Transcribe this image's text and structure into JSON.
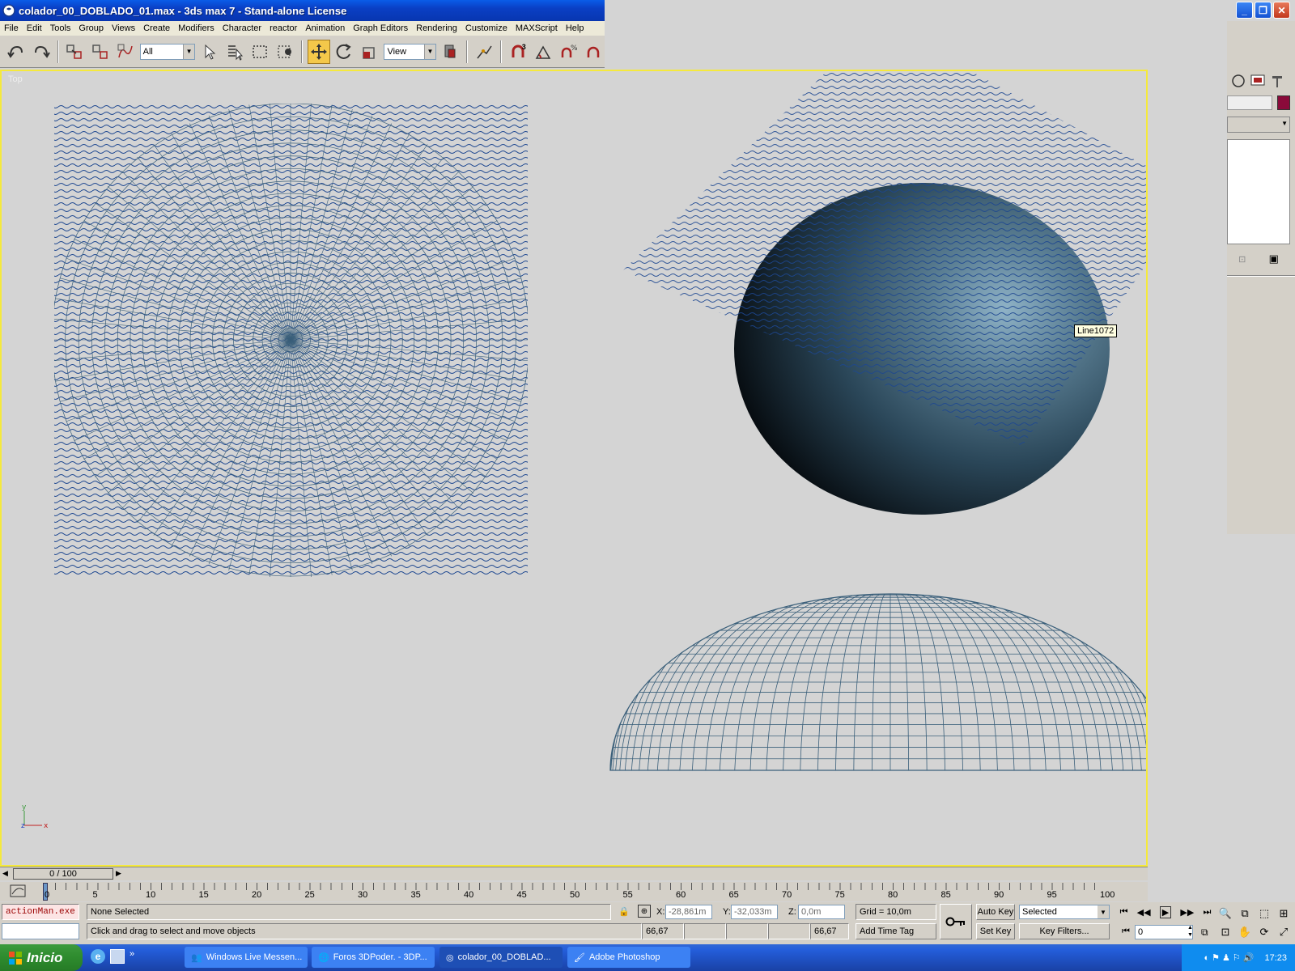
{
  "window": {
    "title": "colador_00_DOBLADO_01.max - 3ds max 7  - Stand-alone License"
  },
  "menu": [
    "File",
    "Edit",
    "Tools",
    "Group",
    "Views",
    "Create",
    "Modifiers",
    "Character",
    "reactor",
    "Animation",
    "Graph Editors",
    "Rendering",
    "Customize",
    "MAXScript",
    "Help"
  ],
  "toolbar": {
    "selection_filter": "All",
    "reference_coord": "View",
    "snap_label": "3"
  },
  "viewport": {
    "tooltip": "Line1072",
    "axis_x": "x",
    "axis_y": "y",
    "axis_z": "z"
  },
  "timeslider": {
    "label": "0 / 100"
  },
  "trackbar": {
    "ticks": [
      "0",
      "5",
      "10",
      "15",
      "20",
      "25",
      "30",
      "35",
      "40",
      "45",
      "50",
      "55",
      "60",
      "65",
      "70",
      "75",
      "80",
      "85",
      "90",
      "95",
      "100"
    ]
  },
  "status": {
    "script_listener": "actionMan.exe",
    "selection": "None Selected",
    "prompt": "Click and drag to select and move objects",
    "x_label": "X:",
    "x_value": "-28,861m",
    "y_label": "Y:",
    "y_value": "-32,033m",
    "z_label": "Z:",
    "z_value": "0,0m",
    "grid": "Grid = 10,0m",
    "auto_key": "Auto Key",
    "set_key": "Set Key",
    "key_mode": "Selected",
    "key_filters": "Key Filters...",
    "add_time_tag": "Add Time Tag",
    "frame": "0",
    "readout_1": "66,67",
    "readout_2": "66,67"
  },
  "taskbar": {
    "start": "Inicio",
    "tasks": [
      "Windows Live Messen...",
      "Foros 3DPoder. - 3DP...",
      "colador_00_DOBLAD...",
      "Adobe Photoshop"
    ],
    "clock": "17:23"
  },
  "colors": {
    "viewport_border": "#f5e93c",
    "wire": "#3a5f7a",
    "titlebar": "#0a3fc4"
  }
}
